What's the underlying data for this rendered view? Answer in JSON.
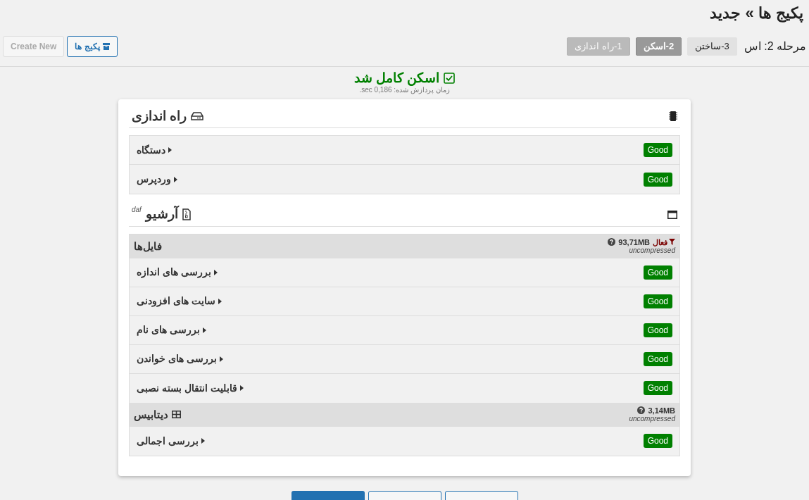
{
  "page_title": "پکیج ها » جدید",
  "toolbar": {
    "create_new": {
      "label": "Create New",
      "disabled": true
    },
    "packages_button": {
      "label": "پکیج ها"
    }
  },
  "step_label": "مرحله 2: اس",
  "steps": [
    {
      "label": "3-ساختن",
      "selected": false,
      "disabled": false
    },
    {
      "label": "2-اسکن",
      "selected": true,
      "disabled": false
    },
    {
      "label": "1-راه اندازی",
      "selected": false,
      "disabled": true
    }
  ],
  "scan_result": {
    "title": "اسکن کامل شد",
    "time": "زمان پردازش شده: 0,186 sec."
  },
  "setup": {
    "title": "راه اندازی",
    "checks": [
      {
        "label": "دستگاه",
        "status": "Good",
        "ok": true
      },
      {
        "label": "وردپرس",
        "status": "Good",
        "ok": true
      }
    ]
  },
  "archive": {
    "title": "آرشیو",
    "note": "daf",
    "groups": [
      {
        "kind": "files",
        "title": "فایل‌ها",
        "filter": "فعال",
        "size": "93,71MB",
        "size_note": "uncompressed",
        "checks": [
          {
            "label": "بررسی های اندازه",
            "status": "Good",
            "ok": true
          },
          {
            "label": "سایت های افزودنی",
            "status": "Good",
            "ok": true
          },
          {
            "label": "بررسی های نام",
            "status": "Good",
            "ok": true
          },
          {
            "label": "بررسی های خواندن",
            "status": "Good",
            "ok": true
          },
          {
            "label": "قابلیت انتقال بسته نصبی",
            "status": "Good",
            "ok": true
          }
        ]
      },
      {
        "kind": "database",
        "title": "دیتابیس",
        "size": "3,14MB",
        "size_note": "uncompressed",
        "checks": [
          {
            "label": "بررسی اجمالی",
            "status": "Good",
            "ok": true
          }
        ]
      }
    ]
  }
}
